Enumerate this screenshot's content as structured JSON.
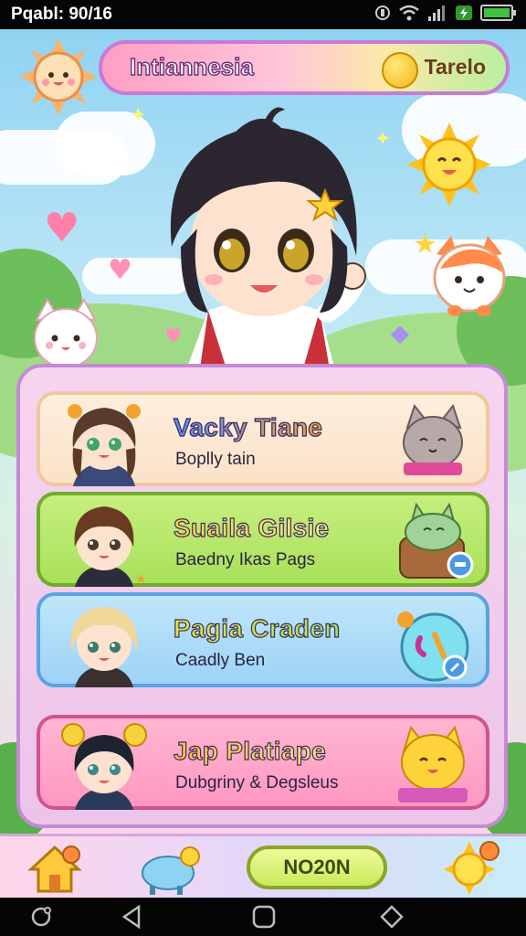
{
  "status_bar": {
    "time": "Pqabl: 90/16"
  },
  "header": {
    "title": "Intiannesia",
    "currency_label": "Tarelo"
  },
  "cards": [
    {
      "title": "Vacky Tiane",
      "subtitle": "Boplly tain",
      "title_colors": [
        "#5a8ff0",
        "#f3a22e"
      ]
    },
    {
      "title": "Suaila Gilsie",
      "subtitle": "Baedny Ikas Pags",
      "title_colors": [
        "#f0d64a",
        "#e9f07a"
      ]
    },
    {
      "title": "Pagia Craden",
      "subtitle": "Caadly Ben",
      "title_colors": [
        "#e3e63f",
        "#a6e25c"
      ]
    },
    {
      "title": "Jap Platiape",
      "subtitle": "Dubgriny & Degsleus",
      "title_colors": [
        "#f7c53a",
        "#ff8ac2"
      ]
    }
  ],
  "bottom_bar": {
    "play_label": "NO20N"
  },
  "icons": {
    "home": "home-icon",
    "pet": "pet-icon",
    "sun": "sun-icon",
    "back": "back-icon",
    "home_nav": "home-nav-icon",
    "recents": "recents-icon",
    "assist": "assist-icon"
  },
  "colors": {
    "panel_border": "#c58ad4",
    "accent_pink": "#ff9ec4",
    "accent_green": "#b9ef9e"
  }
}
